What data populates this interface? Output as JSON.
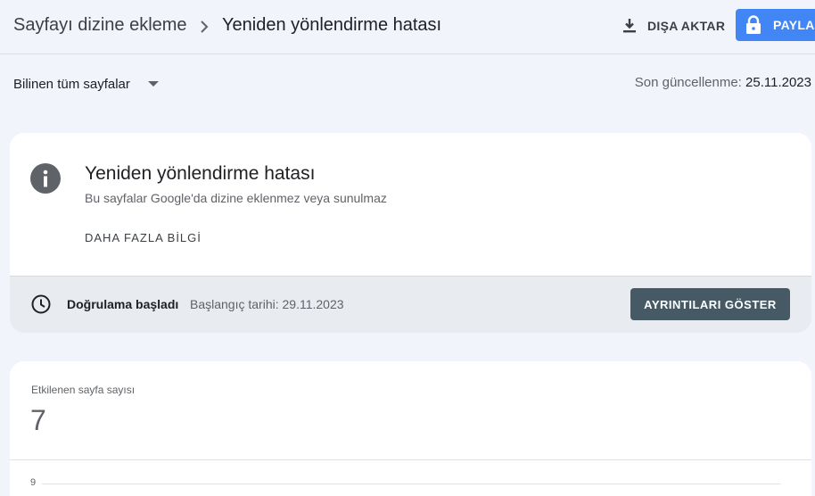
{
  "breadcrumb": {
    "parent": "Sayfayı dizine ekleme",
    "current": "Yeniden yönlendirme hatası"
  },
  "actions": {
    "export_label": "DIŞA AKTAR",
    "share_label": "PAYLAŞ"
  },
  "filter": {
    "selected": "Bilinen tüm sayfalar"
  },
  "last_updated": {
    "label": "Son güncellenme:",
    "value": "25.11.2023"
  },
  "issue": {
    "title": "Yeniden yönlendirme hatası",
    "description": "Bu sayfalar Google'da dizine eklenmez veya sunulmaz",
    "learn_more": "DAHA FAZLA BİLGİ"
  },
  "validation": {
    "status": "Doğrulama başladı",
    "start_date": "Başlangıç tarihi: 29.11.2023",
    "details_button": "AYRINTILARI GÖSTER"
  },
  "metric": {
    "label": "Etkilenen sayfa sayısı",
    "value": "7"
  },
  "chart": {
    "y_tick_top": "9"
  },
  "icons": {
    "export": "download-icon",
    "share": "lock-icon",
    "dropdown": "dropdown-arrow-icon",
    "info": "info-icon",
    "clock": "clock-icon"
  },
  "colors": {
    "background": "#f1f4fb",
    "share_button": "#4285f4",
    "details_button": "#455a64",
    "validation_bar": "#e8ebef",
    "info_icon": "#5f6368"
  }
}
